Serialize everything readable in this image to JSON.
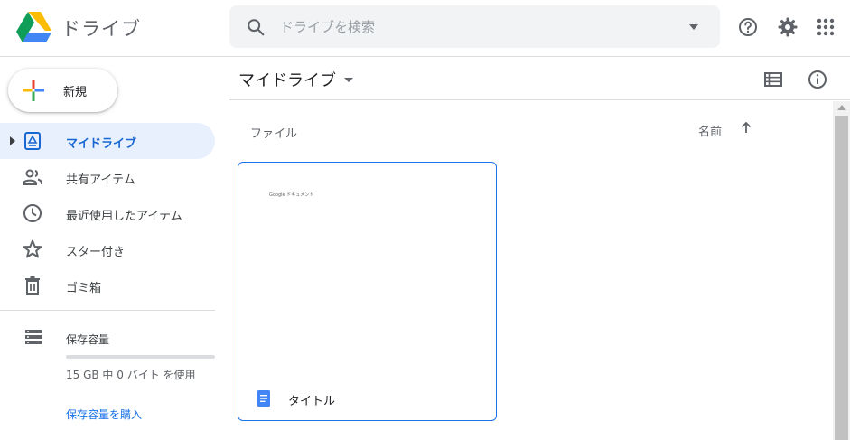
{
  "header": {
    "app_title": "ドライブ",
    "search_placeholder": "ドライブを検索"
  },
  "sidebar": {
    "new_button": "新規",
    "items": [
      {
        "label": "マイドライブ",
        "icon": "my-drive-icon",
        "active": true
      },
      {
        "label": "共有アイテム",
        "icon": "people-icon"
      },
      {
        "label": "最近使用したアイテム",
        "icon": "clock-icon"
      },
      {
        "label": "スター付き",
        "icon": "star-icon"
      },
      {
        "label": "ゴミ箱",
        "icon": "trash-icon"
      }
    ],
    "storage": {
      "label": "保存容量",
      "usage_text": "15 GB 中 0 バイト を使用",
      "used_fraction": 0,
      "buy_link": "保存容量を購入"
    }
  },
  "main": {
    "title": "マイドライブ",
    "files_label": "ファイル",
    "sort_label": "名前",
    "files": [
      {
        "name": "タイトル",
        "preview_text": "Google ドキュメント",
        "type": "docs-icon"
      }
    ]
  },
  "colors": {
    "accent": "#1a73e8",
    "active_bg": "#e8f0fe",
    "active_text": "#1967d2",
    "search_bg": "#f1f3f4"
  }
}
